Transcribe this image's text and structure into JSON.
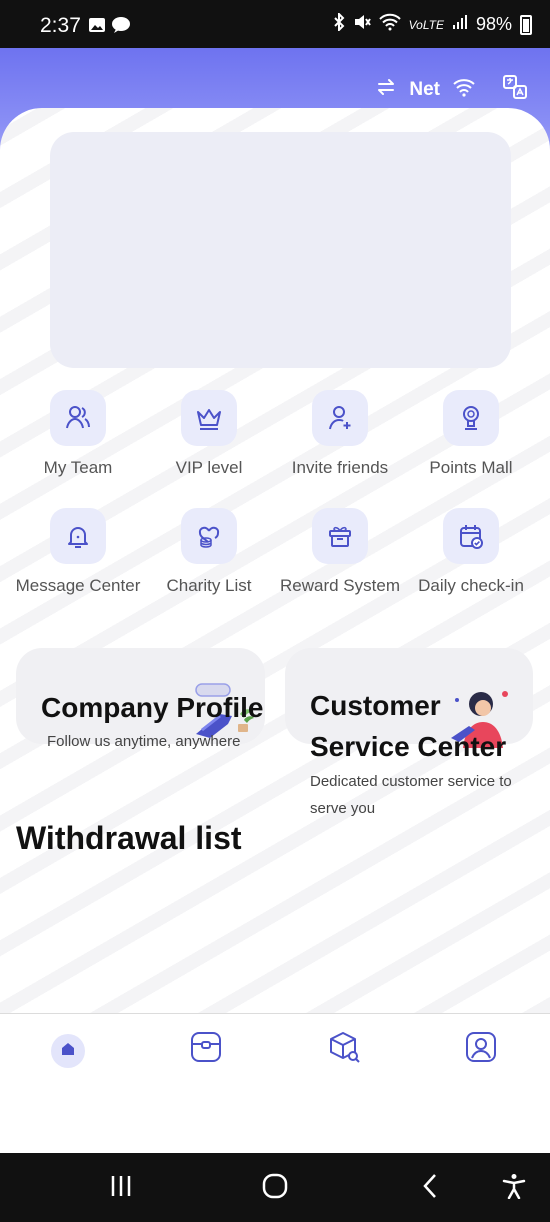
{
  "status_bar": {
    "time": "2:37",
    "battery": "98%",
    "left_icons": [
      "image-icon",
      "talk-icon"
    ],
    "right_icons": [
      "bluetooth-icon",
      "mute-icon",
      "wifi-icon",
      "volte-icon",
      "signal-icon",
      "battery-icon"
    ]
  },
  "header": {
    "net_label": "Net",
    "icons": [
      "switch-icon",
      "wifi-icon",
      "translate-icon"
    ]
  },
  "menu": {
    "items": [
      {
        "label": "My Team",
        "icon": "team-icon"
      },
      {
        "label": "VIP level",
        "icon": "crown-icon"
      },
      {
        "label": "Invite friends",
        "icon": "invite-icon"
      },
      {
        "label": "Points Mall",
        "icon": "trophy-icon"
      },
      {
        "label": "Message Center",
        "icon": "bell-icon"
      },
      {
        "label": "Charity List",
        "icon": "heart-coins-icon"
      },
      {
        "label": "Reward System",
        "icon": "gift-icon"
      },
      {
        "label": "Daily check-in",
        "icon": "calendar-check-icon"
      }
    ]
  },
  "cards": {
    "company": {
      "title": "Company Profile",
      "subtitle": "Follow us anytime, anywhere"
    },
    "service": {
      "title_line1": "Customer",
      "title_line2": "Service Center",
      "subtitle_line1": "Dedicated customer service to",
      "subtitle_line2": "serve you"
    }
  },
  "withdrawal": {
    "title": "Withdrawal list"
  },
  "bottom_nav": {
    "items": [
      {
        "icon": "home-icon",
        "active": true
      },
      {
        "icon": "wallet-icon",
        "active": false
      },
      {
        "icon": "box-search-icon",
        "active": false
      },
      {
        "icon": "profile-icon",
        "active": false
      }
    ]
  },
  "colors": {
    "accent": "#4b52c9",
    "header": "#6e73f0",
    "icon_bg": "#e9ebfb"
  }
}
